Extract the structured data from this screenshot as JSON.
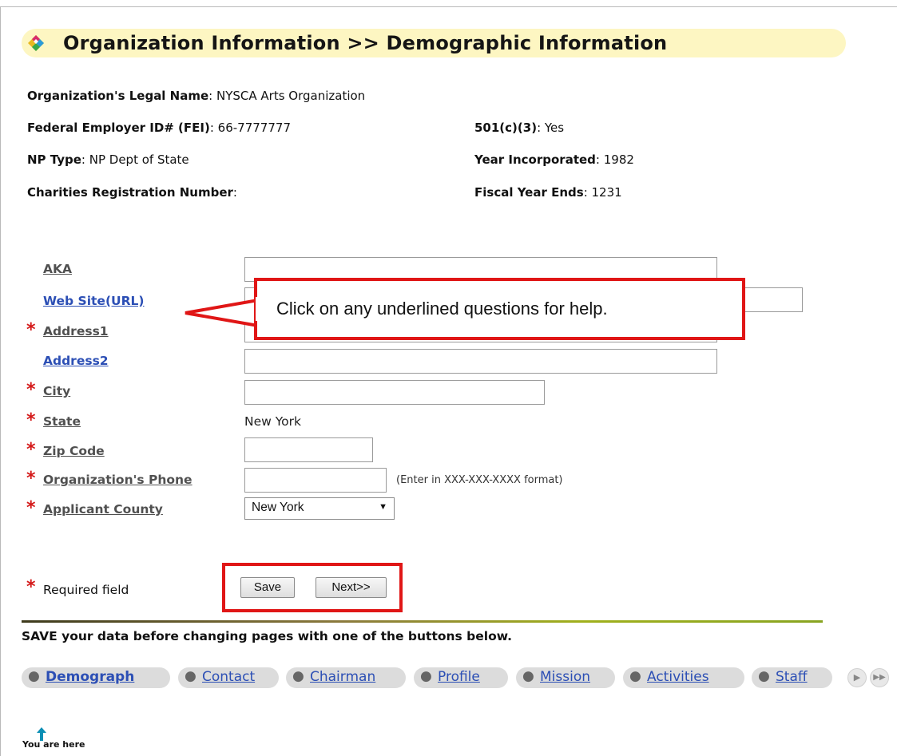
{
  "header": {
    "title": "Organization Information >> Demographic Information",
    "icon": "diamond-logo-icon"
  },
  "org_info": {
    "legal_name_label": "Organization's Legal Name",
    "legal_name_value": ": NYSCA Arts Organization",
    "fei_label": "Federal Employer ID# (FEI)",
    "fei_value": ": 66-7777777",
    "c3_label": "501(c)(3)",
    "c3_value": ": Yes",
    "np_type_label": "NP Type",
    "np_type_value": ": NP Dept of State",
    "year_inc_label": "Year Incorporated",
    "year_inc_value": ": 1982",
    "charities_label": "Charities Registration Number",
    "charities_value": ":",
    "fiscal_label": "Fiscal Year Ends",
    "fiscal_value": ": 1231"
  },
  "form": {
    "aka_label": "AKA",
    "website_label": "Web Site(URL)",
    "address1_label": "Address1",
    "address2_label": "Address2",
    "city_label": "City",
    "state_label": "State",
    "state_value": "New York",
    "zip_label": "Zip Code",
    "phone_label": "Organization's Phone",
    "phone_hint": "(Enter in XXX-XXX-XXXX format)",
    "county_label": "Applicant County",
    "county_value": "New York",
    "required_star": "*",
    "required_note": "Required field"
  },
  "callout": {
    "text": "Click on any underlined questions for help."
  },
  "buttons": {
    "save": "Save",
    "next": "Next>>"
  },
  "save_notice": "SAVE your data before changing pages with one of the buttons below.",
  "nav": {
    "bullet": "●",
    "tabs": [
      "Demograph",
      "Contact",
      "Chairman",
      "Profile",
      "Mission",
      "Activities",
      "Staff"
    ],
    "you_are_here": "You are here"
  },
  "colors": {
    "accent_red": "#e01616",
    "link_blue": "#2c4fb5",
    "title_bg": "#fdf6c2"
  }
}
